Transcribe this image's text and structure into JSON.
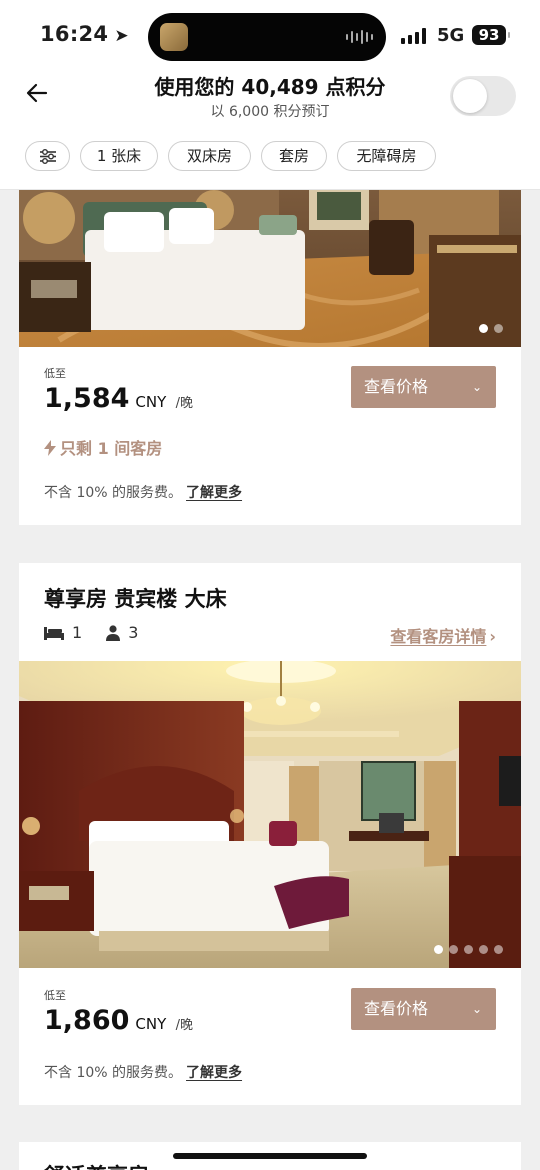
{
  "status": {
    "time": "16:24",
    "network": "5G",
    "battery": "93"
  },
  "header": {
    "title": "使用您的 40,489 点积分",
    "subtitle": "以 6,000 积分预订"
  },
  "filters": [
    "1 张床",
    "双床房",
    "套房",
    "无障碍房"
  ],
  "card1": {
    "low_label": "低至",
    "price": "1,584",
    "currency": "CNY",
    "per_night": "/晚",
    "view_btn": "查看价格",
    "rooms_left": "只剩 1 间客房",
    "fee_text": "不含 10% 的服务费。",
    "learn_more": "了解更多"
  },
  "card2": {
    "name": "尊享房 贵宾楼 大床",
    "beds": "1",
    "guests": "3",
    "detail_link": "查看客房详情",
    "low_label": "低至",
    "price": "1,860",
    "currency": "CNY",
    "per_night": "/晚",
    "view_btn": "查看价格",
    "fee_text": "不含 10% 的服务费。",
    "learn_more": "了解更多"
  },
  "card3": {
    "name_peek": "舒适尊享房"
  },
  "colors": {
    "accent": "#b39180",
    "background": "#efefef",
    "card": "#ffffff"
  },
  "icons": [
    "location-arrow-icon",
    "back-arrow-icon",
    "filter-sliders-icon",
    "lightning-icon",
    "bed-icon",
    "person-icon",
    "chevron-right-icon",
    "chevron-down-icon"
  ]
}
